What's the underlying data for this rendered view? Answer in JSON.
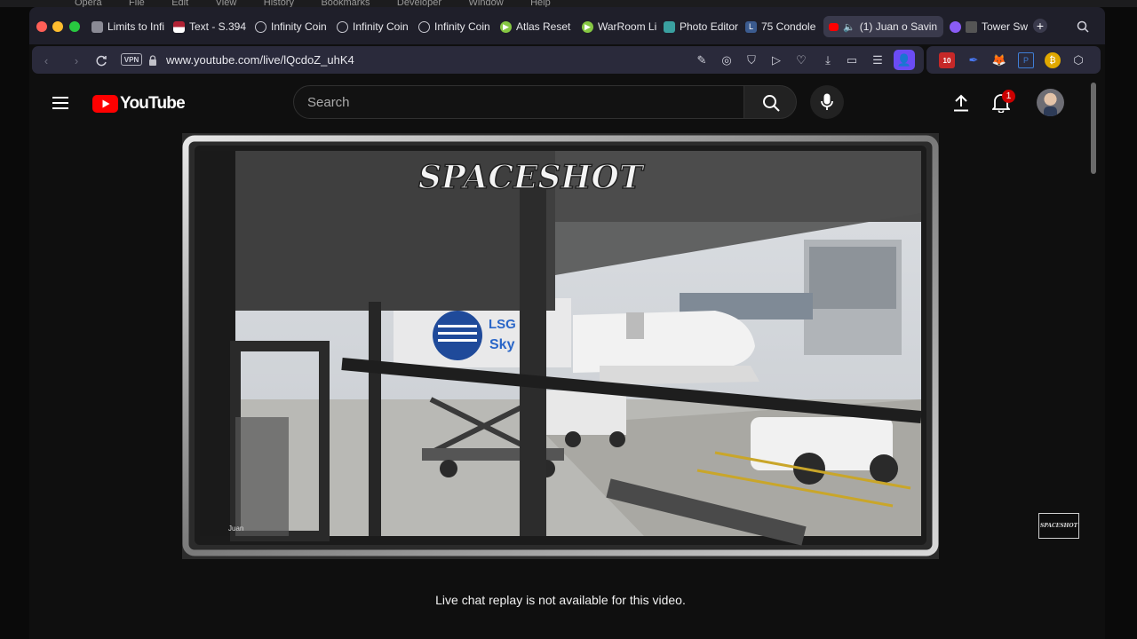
{
  "menubar": {
    "items": [
      "Opera",
      "File",
      "Edit",
      "View",
      "History",
      "Bookmarks",
      "Developer",
      "Window",
      "Help"
    ]
  },
  "tabs": [
    {
      "label": "Limits to Infi",
      "icon": "page-icon",
      "color": "#7a7a85"
    },
    {
      "label": "Text - S.394",
      "icon": "us-flag-icon",
      "color": "#b22234"
    },
    {
      "label": "Infinity Coin",
      "icon": "globe-icon",
      "color": "#c0c0c8"
    },
    {
      "label": "Infinity Coin",
      "icon": "globe-icon",
      "color": "#c0c0c8"
    },
    {
      "label": "Infinity Coin",
      "icon": "globe-icon",
      "color": "#c0c0c8"
    },
    {
      "label": "Atlas Reset",
      "icon": "rumble-icon",
      "color": "#85c742"
    },
    {
      "label": "WarRoom Li",
      "icon": "rumble-icon",
      "color": "#85c742"
    },
    {
      "label": "Photo Editor",
      "icon": "photo-editor-icon",
      "color": "#3aa0a0"
    },
    {
      "label": "75 Condole",
      "icon": "letter-l-icon",
      "color": "#3b5b8f"
    },
    {
      "label": "(1) Juan o Savin",
      "icon": "youtube-icon",
      "color": "#ff0000",
      "active": true
    },
    {
      "label": "Tower Sw",
      "icon": "twitch-icon",
      "color": "#8a5cf5"
    }
  ],
  "addressbar": {
    "vpn_label": "VPN",
    "url": "www.youtube.com/live/lQcdoZ_uhK4"
  },
  "extensions": {
    "badge_count": "10"
  },
  "youtube": {
    "logo_text": "YouTube",
    "search_placeholder": "Search",
    "notification_count": "1",
    "brand_red": "#ff0000"
  },
  "video": {
    "watermark_text": "SPACESHOT",
    "airline_text": "LSG Sky",
    "corner_caption": "Juan",
    "channel_badge": "SPACESHOT"
  },
  "chat": {
    "replay_message": "Live chat replay is not available for this video."
  }
}
